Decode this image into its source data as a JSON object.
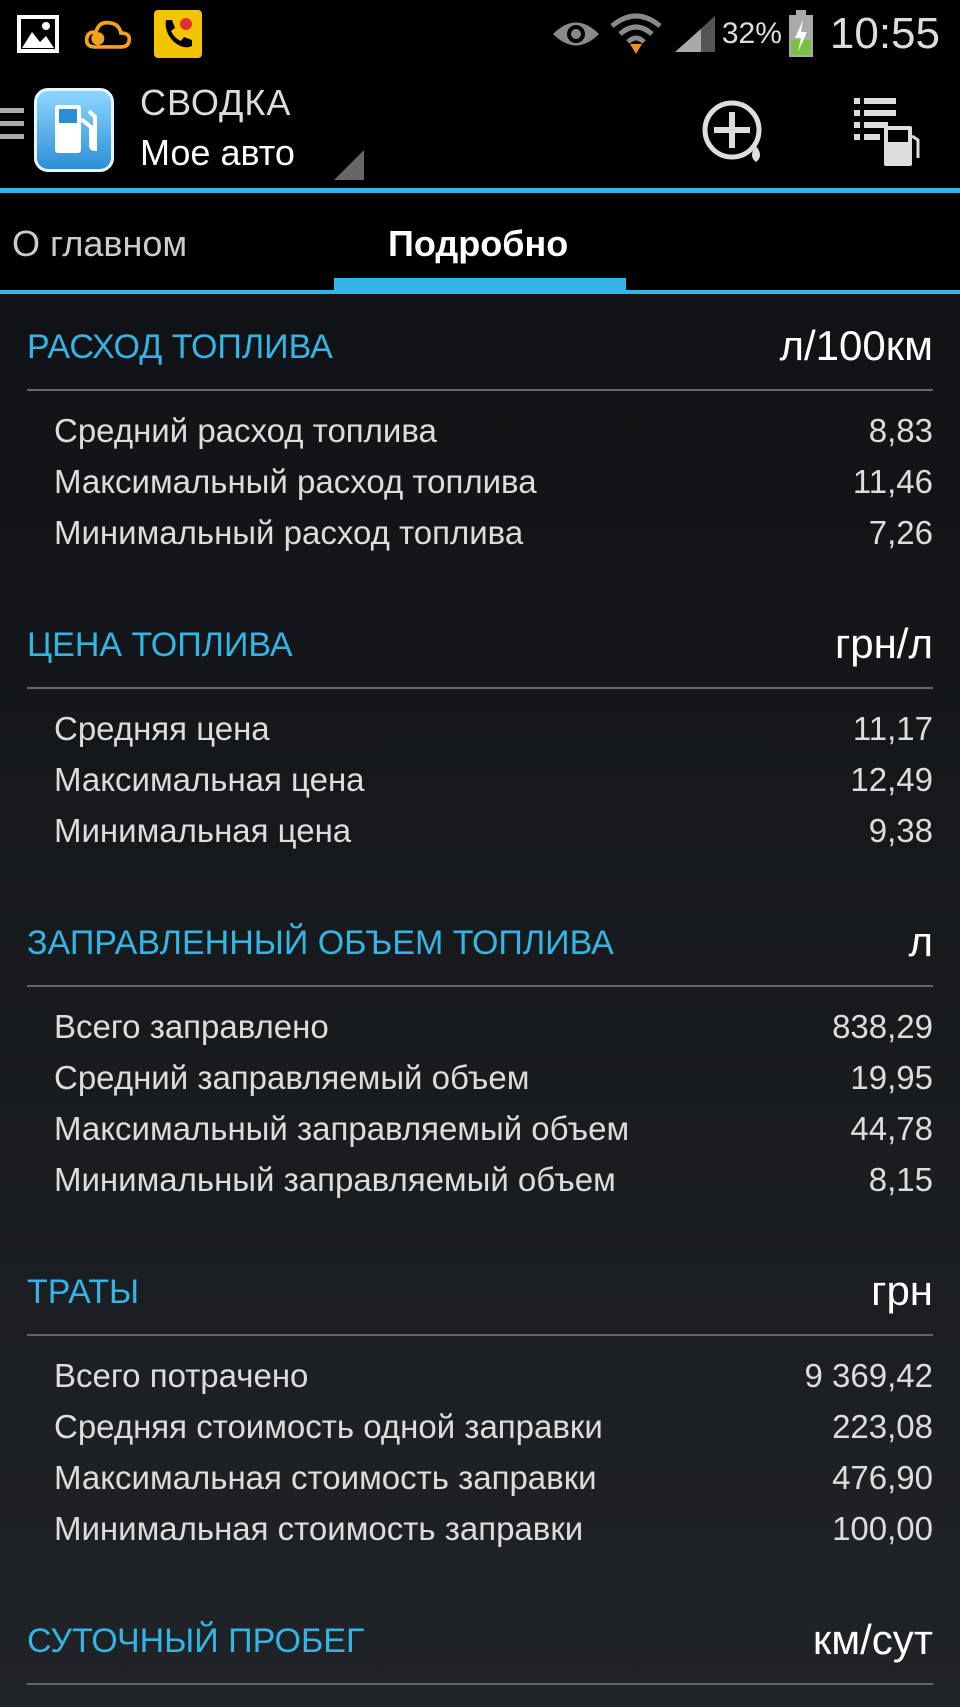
{
  "status_bar": {
    "icons_left": [
      "gallery-icon",
      "cloud-icon",
      "phone-missed-icon"
    ],
    "icons_right": [
      "eye-icon",
      "wifi-icon",
      "signal-icon",
      "battery-icon"
    ],
    "battery_percent": "32%",
    "time": "10:55"
  },
  "action_bar": {
    "title": "СВОДКА",
    "subtitle": "Мое авто"
  },
  "tabs": {
    "main": "О главном",
    "detail": "Подробно"
  },
  "sections": [
    {
      "title": "РАСХОД ТОПЛИВА",
      "unit": "л/100км",
      "rows": [
        {
          "label": "Средний расход топлива",
          "value": "8,83"
        },
        {
          "label": "Максимальный расход топлива",
          "value": "11,46"
        },
        {
          "label": "Минимальный расход топлива",
          "value": "7,26"
        }
      ]
    },
    {
      "title": "ЦЕНА ТОПЛИВА",
      "unit": "грн/л",
      "rows": [
        {
          "label": "Средняя цена",
          "value": "11,17"
        },
        {
          "label": "Максимальная цена",
          "value": "12,49"
        },
        {
          "label": "Минимальная цена",
          "value": "9,38"
        }
      ]
    },
    {
      "title": "ЗАПРАВЛЕННЫЙ ОБЪЕМ ТОПЛИВА",
      "unit": "л",
      "rows": [
        {
          "label": "Всего заправлено",
          "value": "838,29"
        },
        {
          "label": "Средний заправляемый объем",
          "value": "19,95"
        },
        {
          "label": "Максимальный заправляемый объем",
          "value": "44,78"
        },
        {
          "label": "Минимальный заправляемый объем",
          "value": "8,15"
        }
      ]
    },
    {
      "title": "ТРАТЫ",
      "unit": "грн",
      "rows": [
        {
          "label": "Всего потрачено",
          "value": "9 369,42"
        },
        {
          "label": "Средняя стоимость одной заправки",
          "value": "223,08"
        },
        {
          "label": "Максимальная стоимость заправки",
          "value": "476,90"
        },
        {
          "label": "Минимальная стоимость заправки",
          "value": "100,00"
        }
      ]
    },
    {
      "title": "СУТОЧНЫЙ ПРОБЕГ",
      "unit": "км/сут",
      "rows": []
    }
  ]
}
